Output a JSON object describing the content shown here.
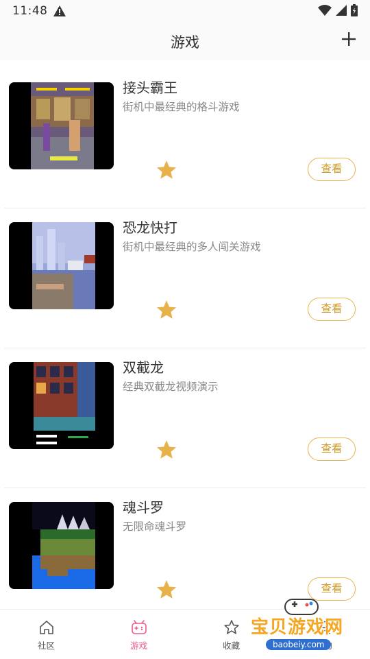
{
  "status": {
    "time": "11:48",
    "alert_icon": "alert-triangle-icon",
    "wifi_icon": "wifi-icon",
    "signal_icon": "signal-icon",
    "battery_icon": "battery-icon"
  },
  "header": {
    "title": "游戏",
    "add_icon": "plus-icon"
  },
  "games": [
    {
      "title": "接头霸王",
      "description": "街机中最经典的格斗游戏",
      "action_label": "查看",
      "thumb": "fighting-game-screenshot"
    },
    {
      "title": "恐龙快打",
      "description": "街机中最经典的多人闯关游戏",
      "action_label": "查看",
      "thumb": "dino-game-screenshot"
    },
    {
      "title": "双截龙",
      "description": "经典双截龙视频演示",
      "action_label": "查看",
      "thumb": "double-dragon-screenshot"
    },
    {
      "title": "魂斗罗",
      "description": "无限命魂斗罗",
      "action_label": "查看",
      "thumb": "contra-screenshot"
    }
  ],
  "bottom_nav": {
    "items": [
      {
        "label": "社区",
        "icon": "home-icon",
        "active": false
      },
      {
        "label": "游戏",
        "icon": "gamepad-icon",
        "active": true
      },
      {
        "label": "收藏",
        "icon": "star-outline-icon",
        "active": false
      },
      {
        "label": "我的",
        "icon": "user-icon",
        "active": false
      }
    ]
  },
  "watermark": {
    "text": "宝贝游戏网",
    "url": "baobeiy.com"
  },
  "colors": {
    "accent": "#ec5a8a",
    "star": "#e8b24a",
    "button_border": "#e8b24a"
  }
}
